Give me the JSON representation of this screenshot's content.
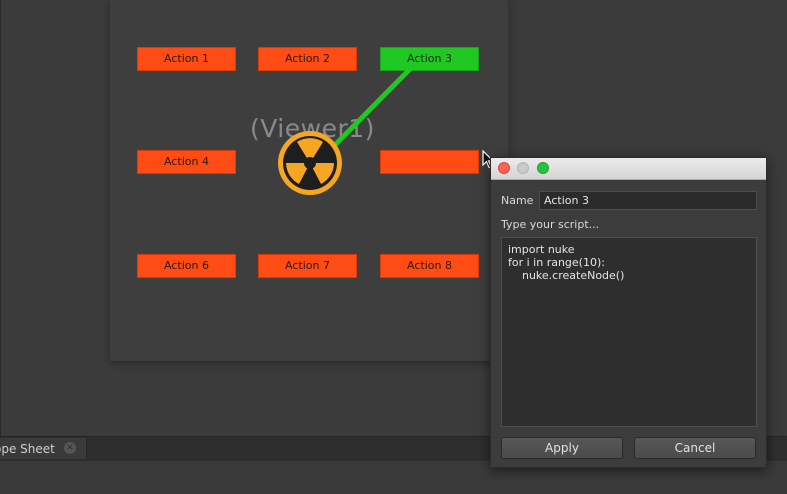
{
  "viewer": {
    "label": "(Viewer1)"
  },
  "actions": {
    "action1": "Action 1",
    "action2": "Action 2",
    "action3": "Action 3",
    "action4": "Action 4",
    "action5": "",
    "action6": "Action 6",
    "action7": "Action 7",
    "action8": "Action 8"
  },
  "colors": {
    "action_orange": "#ff4b14",
    "action_active_green": "#20c822",
    "connector_green": "#20c822",
    "logo_orange": "#f5a623"
  },
  "icons": {
    "logo": "nuke-logo-icon",
    "cursor": "mouse-cursor-icon",
    "tab_close": "close-icon"
  },
  "bottom_panel": {
    "tab_label": "ope Sheet",
    "tab_close": "×"
  },
  "dialog": {
    "name_label": "Name",
    "name_value": "Action 3",
    "script_label": "Type your script...",
    "script_lines": [
      "import nuke",
      "for i in range(10):",
      "    nuke.createNode()"
    ],
    "apply_label": "Apply",
    "cancel_label": "Cancel"
  }
}
